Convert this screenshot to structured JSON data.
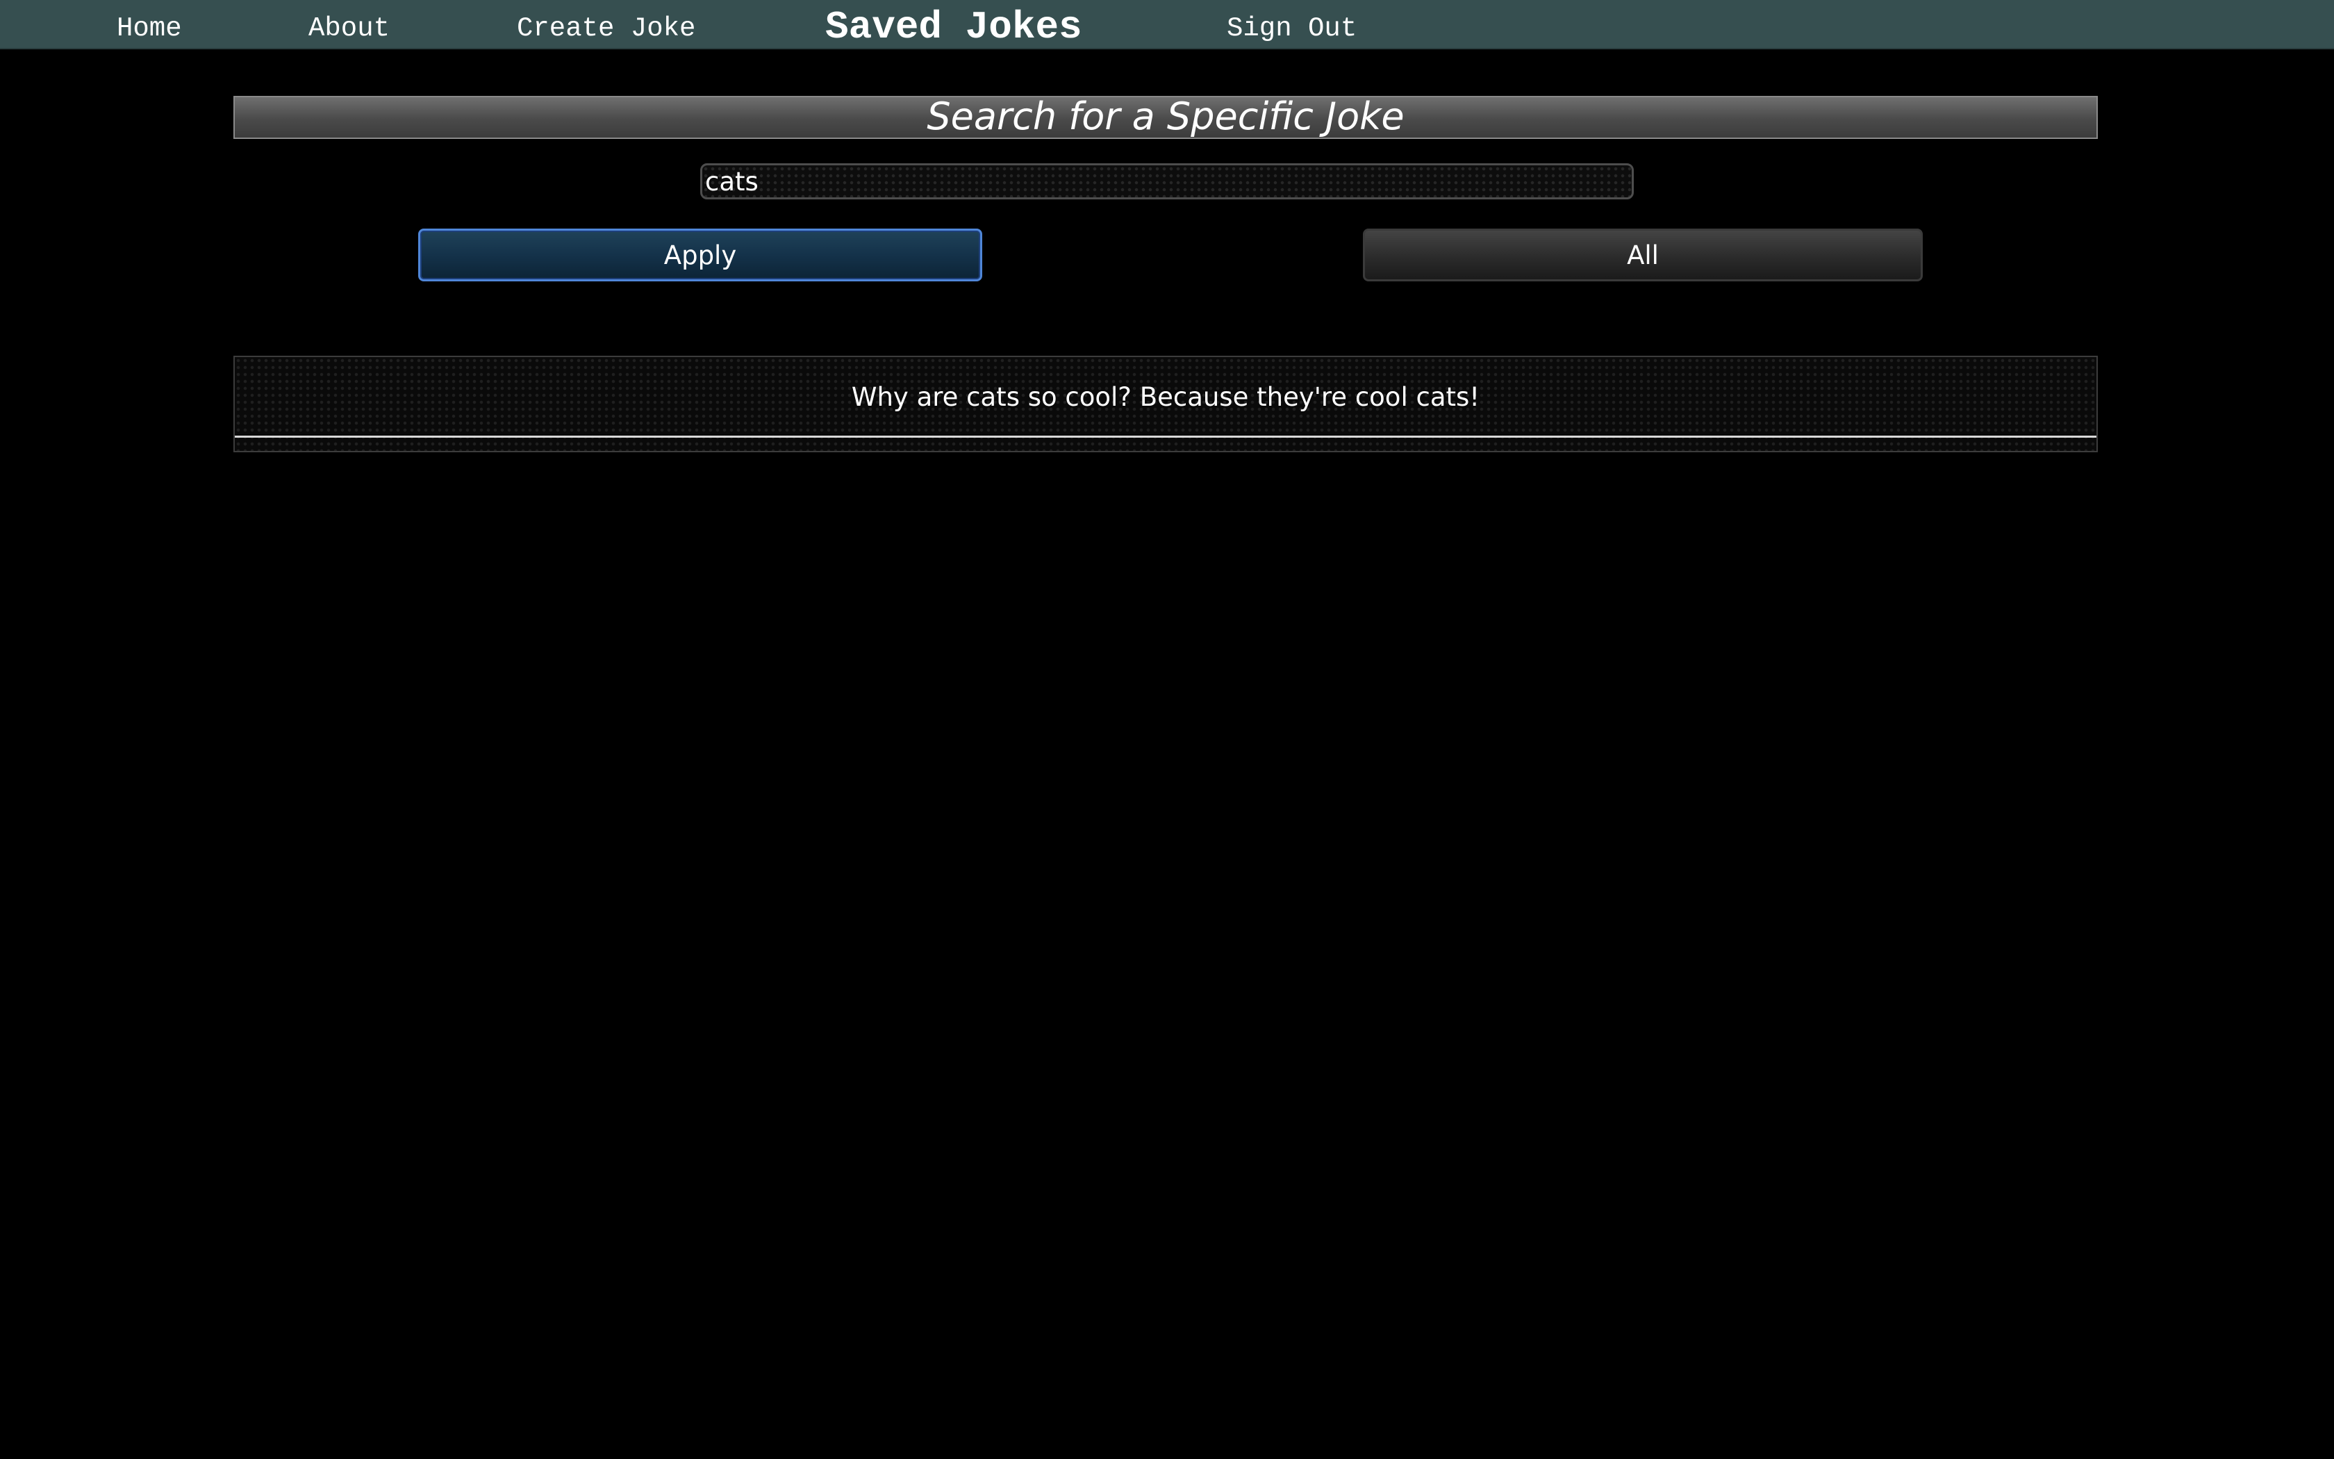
{
  "nav": {
    "items": [
      {
        "label": "Home"
      },
      {
        "label": "About"
      },
      {
        "label": "Create Joke"
      },
      {
        "label": "Saved Jokes",
        "active": true
      },
      {
        "label": "Sign Out"
      }
    ]
  },
  "search": {
    "header": "Search for a Specific Joke",
    "query": "cats",
    "apply_label": "Apply",
    "all_label": "All"
  },
  "jokes": [
    {
      "text": "Why are cats so cool? Because they're cool cats!"
    }
  ],
  "colors": {
    "navbar_bg": "#364f50",
    "apply_border": "#4f86d8",
    "page_bg": "#000000"
  }
}
